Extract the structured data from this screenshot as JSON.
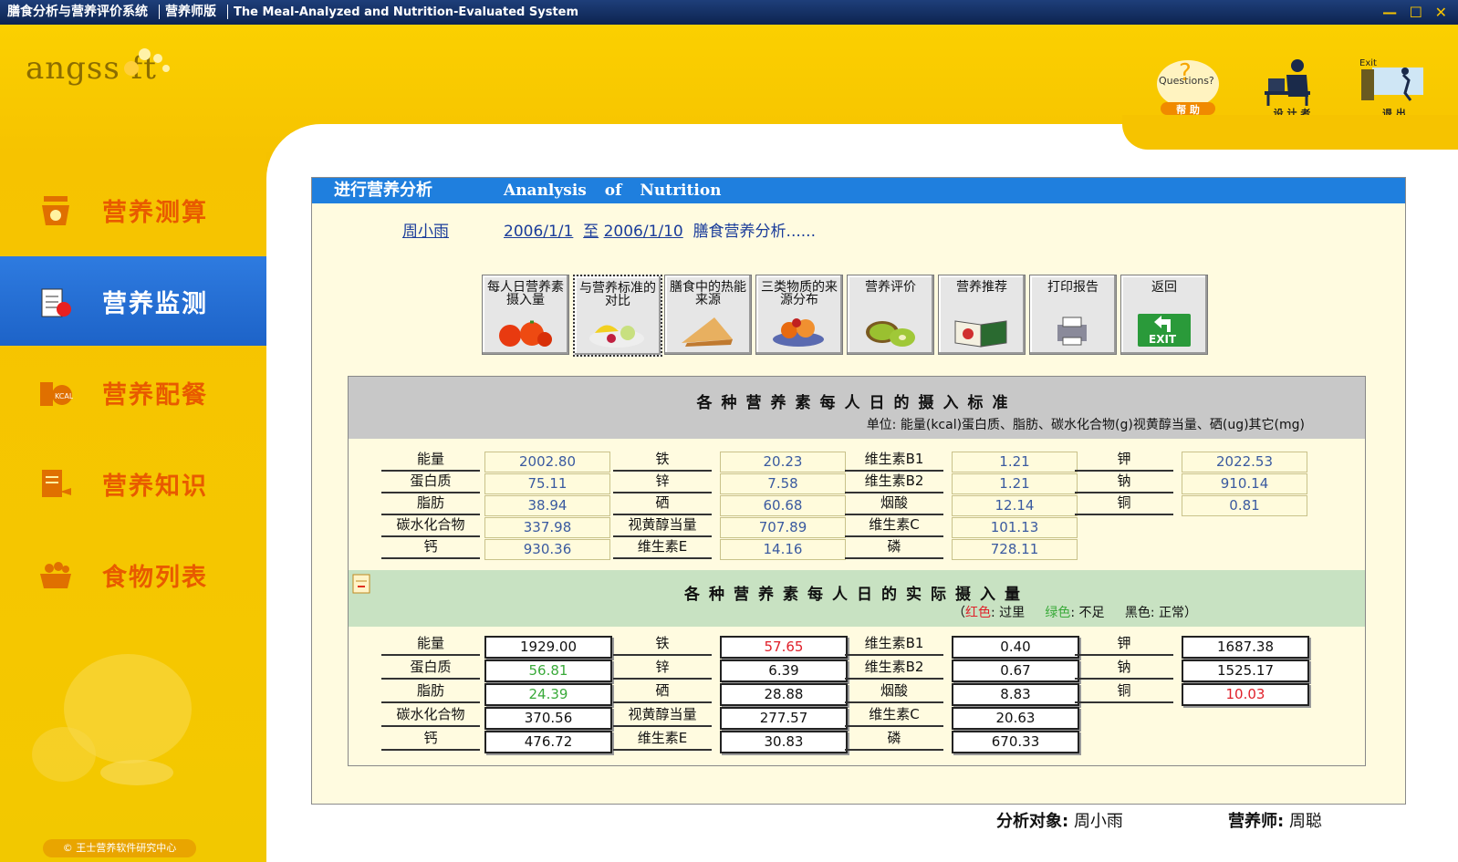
{
  "titlebar": {
    "app": "膳食分析与营养评价系统",
    "edition": "营养师版",
    "english": "The Meal-Analyzed and Nutrition-Evaluated System",
    "min": "—",
    "max": "☐",
    "close": "✕"
  },
  "logo": {
    "text": "angss ft"
  },
  "top_icons": [
    {
      "label": "帮 助",
      "icon": "help-icon",
      "caption": "Questions?"
    },
    {
      "label": "设 计 者",
      "icon": "designer-icon"
    },
    {
      "label": "退 出",
      "icon": "exit-icon",
      "caption": "Exit"
    }
  ],
  "sidebar": {
    "items": [
      {
        "label": "营养测算",
        "icon": "scale-icon"
      },
      {
        "label": "营养监测",
        "icon": "clipboard-icon",
        "active": true
      },
      {
        "label": "营养配餐",
        "icon": "kcal-icon"
      },
      {
        "label": "营养知识",
        "icon": "book-icon"
      },
      {
        "label": "食物列表",
        "icon": "basket-icon"
      }
    ],
    "copyright": "© 王士营养软件研究中心"
  },
  "panel": {
    "title_cn": "进行营养分析",
    "title_en": "Ananlysis of Nutrition",
    "person": "周小雨",
    "date_from": "2006/1/1",
    "to": "至",
    "date_to": "2006/1/10",
    "suffix": "膳食营养分析......"
  },
  "toolbar": [
    {
      "label": "每人日营养素摄入量",
      "icon": "tomato-icon"
    },
    {
      "label": "与营养标准的对比",
      "icon": "fruit-plate-icon"
    },
    {
      "label": "膳食中的热能来源",
      "icon": "pastry-icon"
    },
    {
      "label": "三类物质的来源分布",
      "icon": "food-icon"
    },
    {
      "label": "营养评价",
      "icon": "kiwi-icon"
    },
    {
      "label": "营养推荐",
      "icon": "recipe-book-icon"
    },
    {
      "label": "打印报告",
      "icon": "printer-icon"
    },
    {
      "label": "返回",
      "icon": "exit-sign-icon",
      "caption": "EXIT"
    }
  ],
  "standard": {
    "title": "各种营养素每人日的摄入标准",
    "unit": "单位: 能量(kcal)蛋白质、脂肪、碳水化合物(g)视黄醇当量、硒(ug)其它(mg)",
    "cols": [
      [
        {
          "label": "能量",
          "value": "2002.80"
        },
        {
          "label": "蛋白质",
          "value": "75.11"
        },
        {
          "label": "脂肪",
          "value": "38.94"
        },
        {
          "label": "碳水化合物",
          "value": "337.98"
        },
        {
          "label": "钙",
          "value": "930.36"
        }
      ],
      [
        {
          "label": "铁",
          "value": "20.23"
        },
        {
          "label": "锌",
          "value": "7.58"
        },
        {
          "label": "硒",
          "value": "60.68"
        },
        {
          "label": "视黄醇当量",
          "value": "707.89"
        },
        {
          "label": "维生素E",
          "value": "14.16"
        }
      ],
      [
        {
          "label": "维生素B1",
          "value": "1.21"
        },
        {
          "label": "维生素B2",
          "value": "1.21"
        },
        {
          "label": "烟酸",
          "value": "12.14"
        },
        {
          "label": "维生素C",
          "value": "101.13"
        },
        {
          "label": "磷",
          "value": "728.11"
        }
      ],
      [
        {
          "label": "钾",
          "value": "2022.53"
        },
        {
          "label": "钠",
          "value": "910.14"
        },
        {
          "label": "铜",
          "value": "0.81"
        }
      ]
    ]
  },
  "actual": {
    "title": "各种营养素每人日的实际摄入量",
    "legend_open": "（",
    "legend_red": "红色",
    "legend_red_txt": ": 过里",
    "legend_green": "绿色",
    "legend_green_txt": ": 不足",
    "legend_black": "黑色: 正常）",
    "cols": [
      [
        {
          "label": "能量",
          "value": "1929.00",
          "status": "normal"
        },
        {
          "label": "蛋白质",
          "value": "56.81",
          "status": "low"
        },
        {
          "label": "脂肪",
          "value": "24.39",
          "status": "low"
        },
        {
          "label": "碳水化合物",
          "value": "370.56",
          "status": "normal"
        },
        {
          "label": "钙",
          "value": "476.72",
          "status": "normal"
        }
      ],
      [
        {
          "label": "铁",
          "value": "57.65",
          "status": "high"
        },
        {
          "label": "锌",
          "value": "6.39",
          "status": "normal"
        },
        {
          "label": "硒",
          "value": "28.88",
          "status": "normal"
        },
        {
          "label": "视黄醇当量",
          "value": "277.57",
          "status": "normal"
        },
        {
          "label": "维生素E",
          "value": "30.83",
          "status": "normal"
        }
      ],
      [
        {
          "label": "维生素B1",
          "value": "0.40",
          "status": "normal"
        },
        {
          "label": "维生素B2",
          "value": "0.67",
          "status": "normal"
        },
        {
          "label": "烟酸",
          "value": "8.83",
          "status": "normal"
        },
        {
          "label": "维生素C",
          "value": "20.63",
          "status": "normal"
        },
        {
          "label": "磷",
          "value": "670.33",
          "status": "normal"
        }
      ],
      [
        {
          "label": "钾",
          "value": "1687.38",
          "status": "normal"
        },
        {
          "label": "钠",
          "value": "1525.17",
          "status": "normal"
        },
        {
          "label": "铜",
          "value": "10.03",
          "status": "high"
        }
      ]
    ]
  },
  "footer": {
    "subject_label": "分析对象:",
    "subject": "周小雨",
    "dietitian_label": "营养师:",
    "dietitian": "周聪"
  },
  "colors": {
    "accent": "#1f7fde",
    "sidebar": "#f5c200",
    "over": "#e0202a",
    "under": "#3aaa3a"
  }
}
